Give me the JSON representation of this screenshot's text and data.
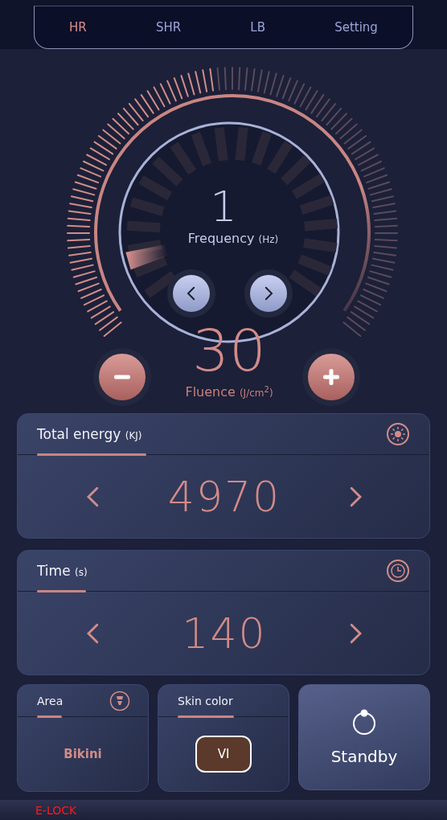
{
  "tabs": [
    {
      "label": "HR",
      "selected": true
    },
    {
      "label": "SHR",
      "selected": false
    },
    {
      "label": "LB",
      "selected": false
    },
    {
      "label": "Setting",
      "selected": false
    }
  ],
  "frequency": {
    "value": "1",
    "label": "Frequency",
    "unit": "(Hz)"
  },
  "fluence": {
    "value": "30",
    "label": "Fluence",
    "unit": "(J/cm$^{2}$)"
  },
  "cards": [
    {
      "kind": "energy",
      "title": "Total energy",
      "unit": "(KJ)",
      "value": "4970"
    },
    {
      "kind": "time",
      "title": "Time",
      "unit": "(s)",
      "value": "140"
    }
  ],
  "area": {
    "title": "Area",
    "value": "Bikini"
  },
  "skin_color": {
    "title": "Skin color",
    "value": "VI"
  },
  "standby": {
    "label": "Standby"
  },
  "status": {
    "label": "E-LOCK"
  }
}
